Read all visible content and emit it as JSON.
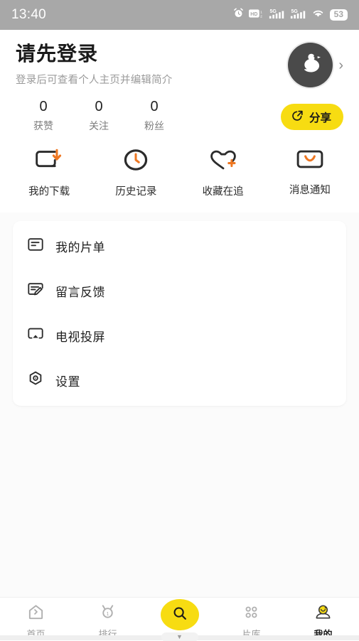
{
  "status_bar": {
    "time": "13:40",
    "icons": [
      "alarm-clock-icon",
      "hd-volte-icon",
      "signal-5g-icon-1",
      "signal-5g-icon-2",
      "wifi-icon"
    ],
    "battery_level": "53"
  },
  "profile": {
    "title": "请先登录",
    "subtitle": "登录后可查看个人主页并编辑简介",
    "avatar_icon": "duck-avatar-icon",
    "chevron": "›",
    "stats": [
      {
        "value": "0",
        "label": "获赞"
      },
      {
        "value": "0",
        "label": "关注"
      },
      {
        "value": "0",
        "label": "粉丝"
      }
    ],
    "share_label": "分享"
  },
  "quick_actions": [
    {
      "label": "我的下载",
      "icon": "download-icon"
    },
    {
      "label": "历史记录",
      "icon": "history-clock-icon"
    },
    {
      "label": "收藏在追",
      "icon": "favorite-heart-plus-icon"
    },
    {
      "label": "消息通知",
      "icon": "message-envelope-icon"
    }
  ],
  "menu": [
    {
      "label": "我的片单",
      "icon": "playlist-icon"
    },
    {
      "label": "留言反馈",
      "icon": "feedback-edit-icon"
    },
    {
      "label": "电视投屏",
      "icon": "cast-screen-icon"
    },
    {
      "label": "设置",
      "icon": "settings-gear-icon"
    }
  ],
  "tabbar": {
    "items": [
      {
        "label": "首页",
        "icon": "home-icon",
        "active": false
      },
      {
        "label": "排行",
        "icon": "ranking-medal-icon",
        "active": false
      },
      {
        "label": "片库",
        "icon": "library-dots-icon",
        "active": false
      },
      {
        "label": "我的",
        "icon": "profile-face-icon",
        "active": true
      }
    ],
    "search_icon": "search-icon"
  },
  "colors": {
    "accent_yellow": "#F7DC12",
    "accent_orange": "#EE7722",
    "dark": "#2B2B2B",
    "page_bg": "#FBFBFB",
    "status_bar_bg": "#A8A8A8"
  }
}
